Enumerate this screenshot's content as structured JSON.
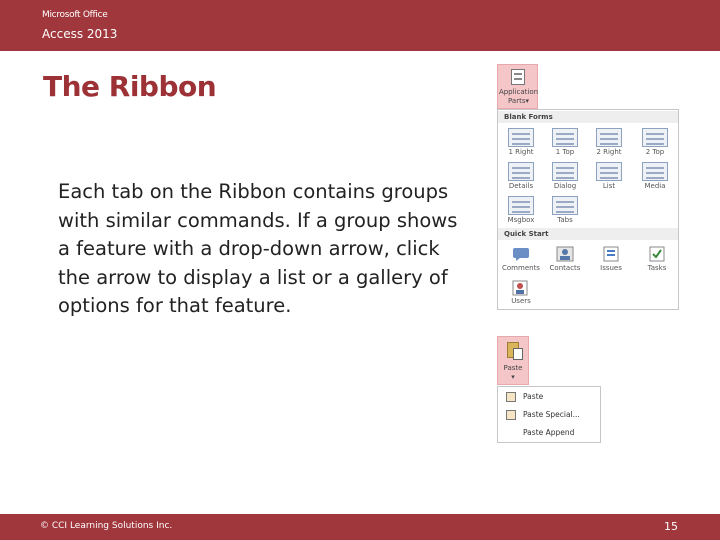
{
  "header": {
    "brand_line1": "Microsoft Office",
    "brand_line2": "Access 2013"
  },
  "slide": {
    "title": "The Ribbon",
    "body": "Each tab on the Ribbon contains groups with similar commands. If a group shows a feature with a drop-down arrow, click the arrow to display a list or a gallery of options for that feature."
  },
  "footer": {
    "copyright": "© CCI Learning Solutions Inc.",
    "page_number": "15"
  },
  "app_parts": {
    "button_label_line1": "Application",
    "button_label_line2": "Parts▾",
    "blank_forms_header": "Blank Forms",
    "blank_forms": [
      "1 Right",
      "1 Top",
      "2 Right",
      "2 Top",
      "Details",
      "Dialog",
      "List",
      "Media",
      "Msgbox",
      "Tabs"
    ],
    "quick_start_header": "Quick Start",
    "quick_start": [
      "Comments",
      "Contacts",
      "Issues",
      "Tasks",
      "Users"
    ]
  },
  "paste": {
    "button_label": "Paste",
    "arrow": "▾",
    "menu_items": [
      "Paste",
      "Paste Special...",
      "Paste Append"
    ]
  }
}
